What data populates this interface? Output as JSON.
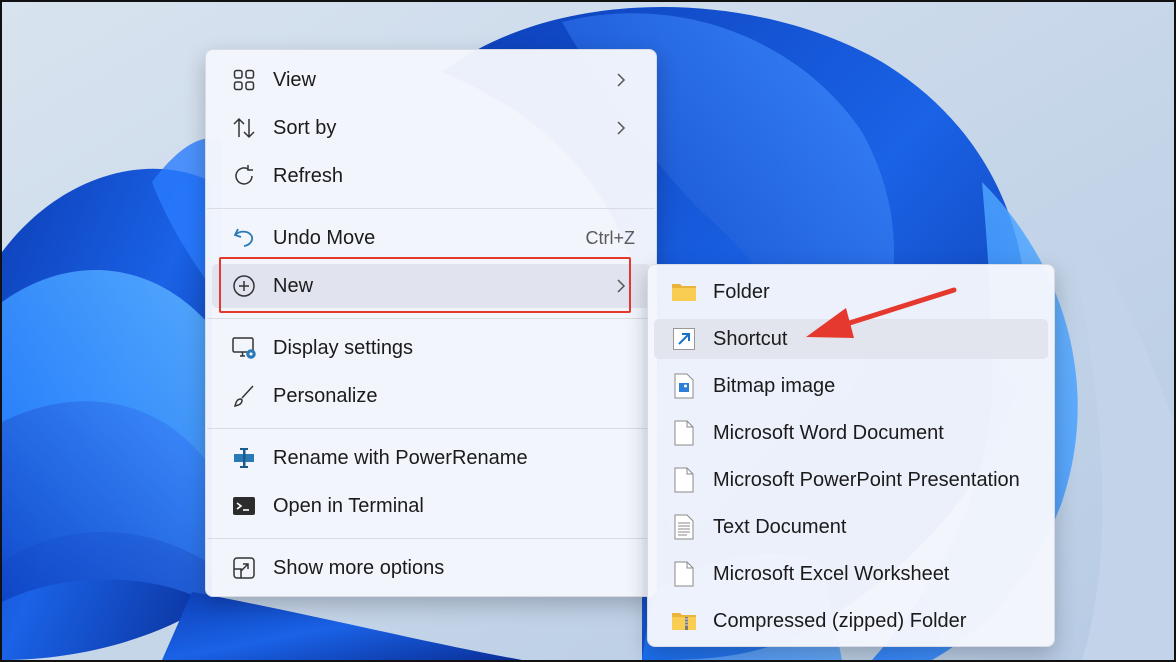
{
  "context_menu": {
    "items": [
      {
        "label": "View",
        "icon": "view-grid-icon",
        "has_submenu": true
      },
      {
        "label": "Sort by",
        "icon": "sort-icon",
        "has_submenu": true
      },
      {
        "label": "Refresh",
        "icon": "refresh-icon"
      },
      {
        "label": "Undo Move",
        "icon": "undo-icon",
        "shortcut": "Ctrl+Z"
      },
      {
        "label": "New",
        "icon": "plus-circle-icon",
        "has_submenu": true,
        "highlighted": true
      },
      {
        "label": "Display settings",
        "icon": "display-settings-icon"
      },
      {
        "label": "Personalize",
        "icon": "brush-icon"
      },
      {
        "label": "Rename with PowerRename",
        "icon": "powerrename-icon"
      },
      {
        "label": "Open in Terminal",
        "icon": "terminal-icon"
      },
      {
        "label": "Show more options",
        "icon": "show-more-icon"
      }
    ]
  },
  "new_submenu": {
    "items": [
      {
        "label": "Folder",
        "icon": "folder-icon"
      },
      {
        "label": "Shortcut",
        "icon": "shortcut-icon",
        "hovered": true
      },
      {
        "label": "Bitmap image",
        "icon": "bitmap-icon"
      },
      {
        "label": "Microsoft Word Document",
        "icon": "document-icon"
      },
      {
        "label": "Microsoft PowerPoint Presentation",
        "icon": "document-icon"
      },
      {
        "label": "Text Document",
        "icon": "text-document-icon"
      },
      {
        "label": "Microsoft Excel Worksheet",
        "icon": "document-icon"
      },
      {
        "label": "Compressed (zipped) Folder",
        "icon": "zip-folder-icon"
      }
    ]
  },
  "colors": {
    "annotation_red": "#e5392f",
    "wallpaper_blue": "#1a5fe0",
    "wallpaper_background": "#c5d6ea"
  }
}
